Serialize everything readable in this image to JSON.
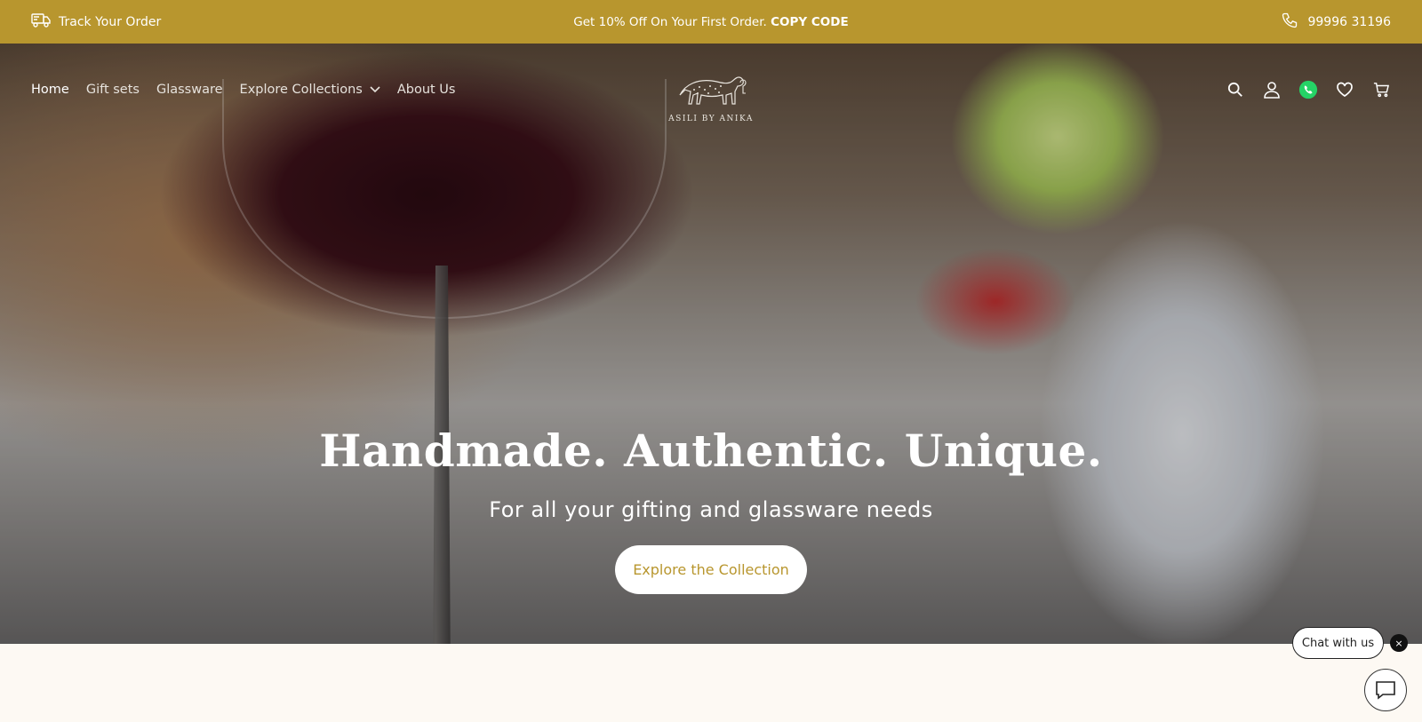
{
  "announcement": {
    "track_order": "Track Your Order",
    "promo_text": "Get 10% Off On Your First Order.",
    "promo_code_label": "COPY CODE",
    "phone": "99996 31196"
  },
  "nav": {
    "items": [
      {
        "label": "Home"
      },
      {
        "label": "Gift sets"
      },
      {
        "label": "Glassware"
      },
      {
        "label": "Explore Collections"
      },
      {
        "label": "About Us"
      }
    ],
    "logo_text": "ASILI BY ANIKA",
    "icons": [
      "search-icon",
      "account-icon",
      "whatsapp-icon",
      "wishlist-icon",
      "cart-icon"
    ]
  },
  "hero": {
    "headline": "Handmade. Authentic. Unique.",
    "subline": "For all your gifting and glassware needs",
    "cta_label": "Explore the Collection"
  },
  "chat": {
    "label": "Chat with us",
    "close_symbol": "×"
  },
  "colors": {
    "accent": "#b8962e",
    "background": "#fdf9f3",
    "whatsapp": "#25d366"
  }
}
